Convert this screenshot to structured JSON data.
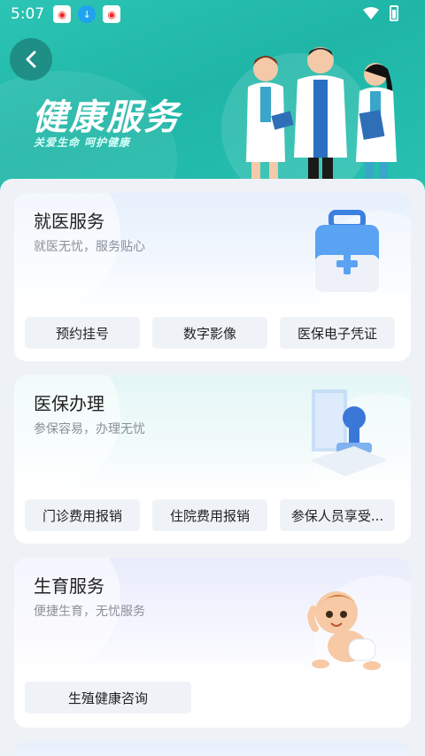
{
  "status_bar": {
    "time": "5:07"
  },
  "header": {
    "title": "健康服务",
    "subtitle": "关爱生命 呵护健康"
  },
  "colors": {
    "header_teal": "#22bdad",
    "back_button": "#1f8e85",
    "pill_bg": "#eff3f8"
  },
  "cards": [
    {
      "title": "就医服务",
      "subtitle": "就医无忧，服务贴心",
      "icon": "medical-kit-icon",
      "buttons": [
        "预约挂号",
        "数字影像",
        "医保电子凭证"
      ]
    },
    {
      "title": "医保办理",
      "subtitle": "参保容易，办理无忧",
      "icon": "stamp-icon",
      "buttons": [
        "门诊费用报销",
        "住院费用报销",
        "参保人员享受..."
      ]
    },
    {
      "title": "生育服务",
      "subtitle": "便捷生育，无忧服务",
      "icon": "baby-icon",
      "buttons": [
        "生殖健康咨询"
      ]
    }
  ]
}
